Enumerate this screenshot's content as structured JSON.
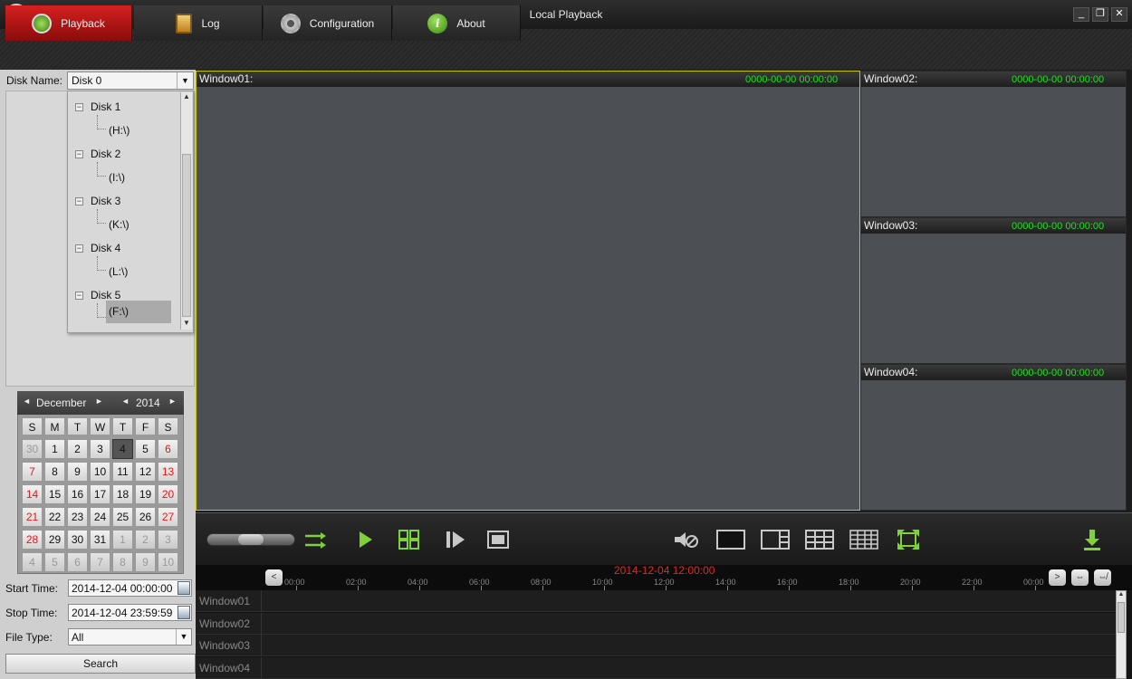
{
  "window": {
    "title": "Local Playback",
    "minimize": "_",
    "restore": "❐",
    "close": "✕"
  },
  "tabs": [
    {
      "label": "Playback",
      "icon": "playback-icon"
    },
    {
      "label": "Log",
      "icon": "clipboard-icon"
    },
    {
      "label": "Configuration",
      "icon": "gear-icon"
    },
    {
      "label": "About",
      "icon": "info-icon"
    }
  ],
  "disk": {
    "label": "Disk Name:",
    "selected": "Disk 0"
  },
  "tree": [
    {
      "disk": "Disk 1",
      "drive": "(H:\\)"
    },
    {
      "disk": "Disk 2",
      "drive": "(I:\\)"
    },
    {
      "disk": "Disk 3",
      "drive": "(K:\\)"
    },
    {
      "disk": "Disk 4",
      "drive": "(L:\\)"
    },
    {
      "disk": "Disk 5",
      "drive": "(F:\\)"
    }
  ],
  "calendar": {
    "month": "December",
    "year": "2014",
    "weekdays": [
      "S",
      "M",
      "T",
      "W",
      "T",
      "F",
      "S"
    ],
    "weeks": [
      [
        "30",
        "1",
        "2",
        "3",
        "4",
        "5",
        "6"
      ],
      [
        "7",
        "8",
        "9",
        "10",
        "11",
        "12",
        "13"
      ],
      [
        "14",
        "15",
        "16",
        "17",
        "18",
        "19",
        "20"
      ],
      [
        "21",
        "22",
        "23",
        "24",
        "25",
        "26",
        "27"
      ],
      [
        "28",
        "29",
        "30",
        "31",
        "1",
        "2",
        "3"
      ],
      [
        "4",
        "5",
        "6",
        "7",
        "8",
        "9",
        "10"
      ]
    ],
    "selected_day": "4"
  },
  "search_form": {
    "start_label": "Start Time:",
    "start_value": "2014-12-04 00:00:00",
    "stop_label": "Stop Time:",
    "stop_value": "2014-12-04 23:59:59",
    "filetype_label": "File Type:",
    "filetype_value": "All",
    "search_label": "Search"
  },
  "video_windows": [
    {
      "name": "Window01:",
      "time": "0000-00-00 00:00:00"
    },
    {
      "name": "Window02:",
      "time": "0000-00-00 00:00:00"
    },
    {
      "name": "Window03:",
      "time": "0000-00-00 00:00:00"
    },
    {
      "name": "Window04:",
      "time": "0000-00-00 00:00:00"
    }
  ],
  "timeline": {
    "current": "2014-12-04 12:00:00",
    "ticks": [
      "00:00",
      "02:00",
      "04:00",
      "06:00",
      "08:00",
      "10:00",
      "12:00",
      "14:00",
      "16:00",
      "18:00",
      "20:00",
      "22:00",
      "00:00"
    ],
    "rows": [
      "Window01",
      "Window02",
      "Window03",
      "Window04"
    ]
  },
  "colors": {
    "accent_red": "#c41414",
    "time_green": "#22e022",
    "icon_green": "#7fd03a"
  }
}
